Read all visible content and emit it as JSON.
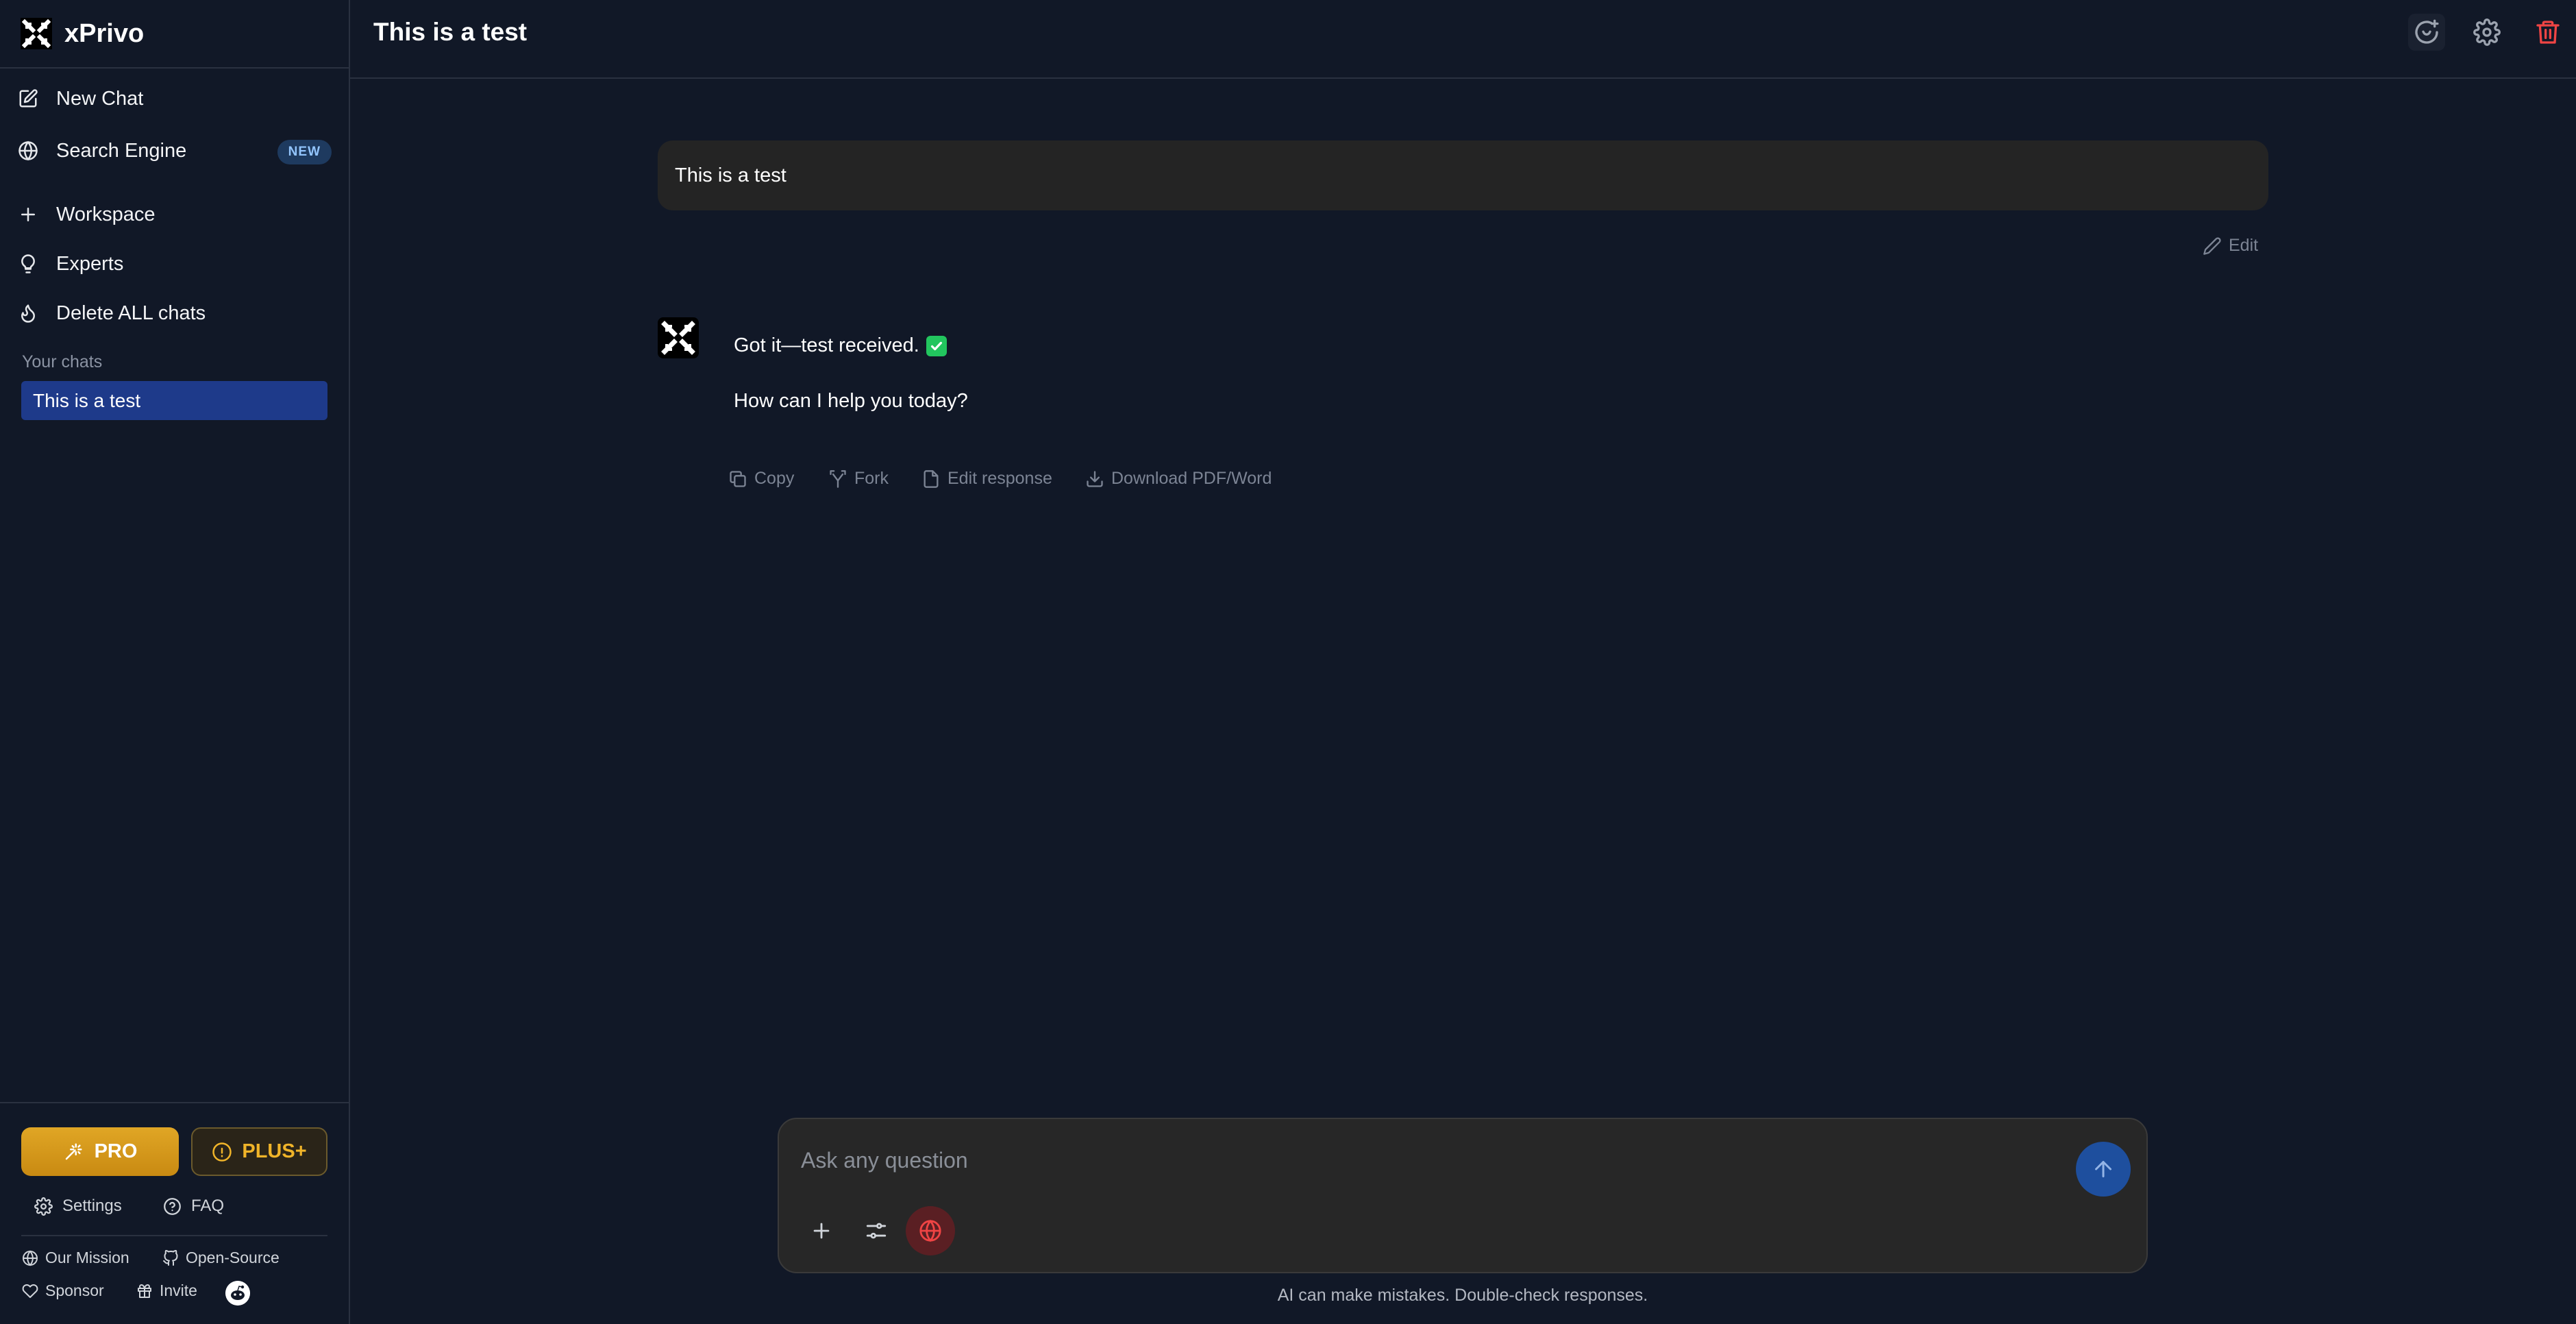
{
  "app": {
    "name": "xPrivo"
  },
  "sidebar": {
    "nav": [
      {
        "label": "New Chat",
        "icon": "edit-icon"
      },
      {
        "label": "Search Engine",
        "icon": "globe-icon",
        "badge": "NEW"
      },
      {
        "label": "Workspace",
        "icon": "plus-icon"
      },
      {
        "label": "Experts",
        "icon": "lightbulb-icon"
      },
      {
        "label": "Delete ALL chats",
        "icon": "flame-icon"
      }
    ],
    "section_label": "Your chats",
    "chats": [
      {
        "title": "This is a test",
        "active": true
      }
    ],
    "pro_label": "PRO",
    "plus_label": "PLUS+",
    "settings_label": "Settings",
    "faq_label": "FAQ",
    "mission_label": "Our Mission",
    "opensource_label": "Open-Source",
    "sponsor_label": "Sponsor",
    "invite_label": "Invite"
  },
  "header": {
    "title": "This is a test",
    "icons": [
      "new-chat-icon",
      "gear-icon",
      "trash-icon"
    ]
  },
  "conversation": {
    "user_message": "This is a test",
    "edit_label": "Edit",
    "assistant_line1": "Got it—test received.",
    "assistant_line1_emoji": "check-mark-button-icon",
    "assistant_line2": "How can I help you today?",
    "actions": {
      "copy": "Copy",
      "fork": "Fork",
      "edit_response": "Edit response",
      "download": "Download PDF/Word"
    }
  },
  "composer": {
    "placeholder": "Ask any question",
    "disclaimer": "AI can make mistakes. Double-check responses."
  },
  "colors": {
    "background": "#111827",
    "accent_blue": "#1e3a8a",
    "pro_gold": "#e0a625",
    "danger_red": "#ef4444"
  }
}
